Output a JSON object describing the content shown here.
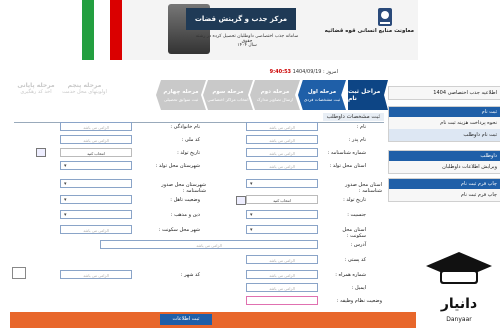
{
  "banner": {
    "org_name": "معاونت منابع انسانی قوه قضائیه",
    "center_title": "مرکز جذب و گزینش قضات",
    "sub_line1": "سامانه جذب اختصاصی داوطلبان تحصیل کرده در رشته حقوق",
    "sub_line2": "سال ۱۴۰۴"
  },
  "date_line": {
    "label": "امروز : 1404/09/19",
    "time": "9:40:53"
  },
  "steps": [
    {
      "title": "مراحل ثبت نام",
      "sub": ""
    },
    {
      "title": "مرحله اول",
      "sub": "ثبت مشخصات فردی"
    },
    {
      "title": "مرحله دوم",
      "sub": "ارسال تصاویر مدارک"
    },
    {
      "title": "مرحله سوم",
      "sub": "انتخاب مراکز اختصاصی"
    },
    {
      "title": "مرحله چهارم",
      "sub": "ثبت سوابق تحصیلی"
    },
    {
      "title": "مرحله پنجم",
      "sub": "اولویتهای محل خدمت"
    },
    {
      "title": "مرحله پایانی",
      "sub": "اخذ کد رهگیری"
    }
  ],
  "sidebar": {
    "box1_head": "",
    "box1_items": [
      "اطلاعیه جذب اختصاصی 1404"
    ],
    "box2_head": "ثبت نام",
    "box2_items": [
      "نحوه پرداخت هزینه ثبت نام",
      "ثبت نام داوطلب"
    ],
    "box3_head": "داوطلب",
    "box3_items": [
      "ویرایش اطلاعات داوطلبان"
    ],
    "box4_head": "چاپ فرم ثبت نام",
    "box4_items": [
      "چاپ فرم ثبت نام"
    ]
  },
  "section_title": "ثبت مشخصات داوطلب",
  "form": {
    "labels": {
      "name": "نام :",
      "family": "نام خانوادگی :",
      "father": "نام پدر :",
      "id_no": "کد ملی :",
      "serial": "شماره شناسنامه :",
      "birth_date": "تاریخ تولد :",
      "birth_province": "استان محل تولد :",
      "birth_city": "شهرستان محل تولد :",
      "issue_province": "استان محل صدور شناسنامه :",
      "issue_city": "شهرستان محل صدور شناسنامه :",
      "gender": "جنسیت :",
      "marital": "وضعیت تاهل :",
      "religion": "دین و مذهب :",
      "residence_province": "استان محل سکونت :",
      "residence_city": "شهر محل سکونت :",
      "address": "آدرس :",
      "postal": "کد پستی :",
      "phone": "تلفن ثابت :",
      "mobile": "شماره همراه :",
      "email": "ایمیل :",
      "city_code": "کد شهر :",
      "military": "وضعیت نظام وظیفه :"
    },
    "placeholder": "الزامی می باشد",
    "placeholder2": "الزامی می باشد",
    "selected_gender": "انتخاب کنید",
    "selected_date": "انتخاب کنید",
    "submit_label": "ثبت اطلاعات"
  },
  "logo": {
    "text": "دانیار",
    "sub": "Danyaar"
  }
}
